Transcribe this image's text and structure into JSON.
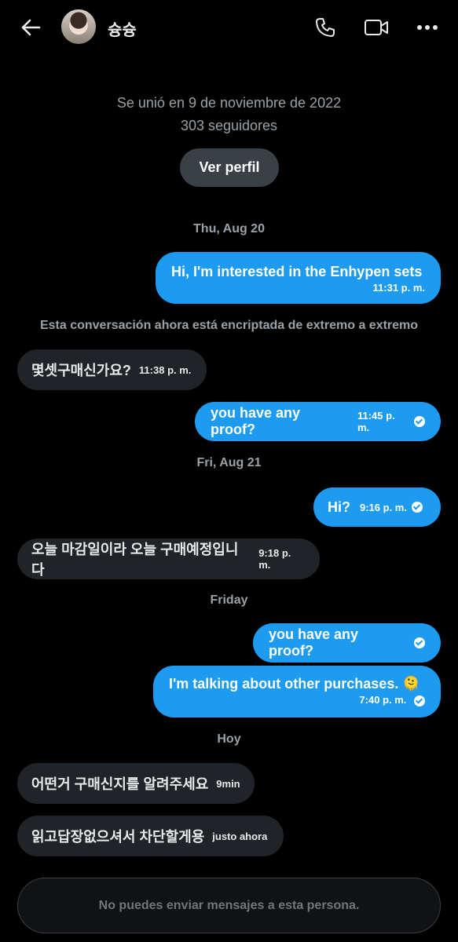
{
  "header": {
    "name": "슝슝",
    "icons": [
      "back-arrow-icon",
      "phone-icon",
      "video-icon",
      "more-icon"
    ]
  },
  "profile": {
    "joined": "Se unió en 9 de noviembre de 2022",
    "followers": "303 seguidores",
    "view_button": "Ver perfil"
  },
  "dates": {
    "d1": "Thu, Aug 20",
    "d2": "Fri, Aug 21",
    "d3": "Friday",
    "d4": "Hoy"
  },
  "notice": "Esta conversación ahora está encriptada de extremo a extremo",
  "messages": {
    "m1": {
      "text": "Hi, I'm interested in the Enhypen sets",
      "time": "11:31 p. m."
    },
    "m2": {
      "text": "몇셋구매신가요?",
      "time": "11:38 p. m."
    },
    "m3": {
      "text": "you have any proof?",
      "time": "11:45 p. m."
    },
    "m4": {
      "text": "Hi?",
      "time": "9:16 p. m."
    },
    "m5": {
      "text": "오늘 마감일이라 오늘 구매예정입니다",
      "time": "9:18 p. m."
    },
    "m6": {
      "text": "you have any proof?",
      "time": ""
    },
    "m7": {
      "text": "I'm talking about other purchases. 🫠",
      "time": "7:40 p. m."
    },
    "m8": {
      "text": "어떤거 구매신지를 알려주세요",
      "time": "9min"
    },
    "m9": {
      "text": "읽고답장없으셔서 차단할게용",
      "time": "justo ahora"
    }
  },
  "composer": {
    "disabled_text": "No puedes enviar mensajes a esta persona."
  },
  "colors": {
    "sent_bubble": "#1d9bf0",
    "received_bubble": "#202327",
    "background": "#000000"
  }
}
